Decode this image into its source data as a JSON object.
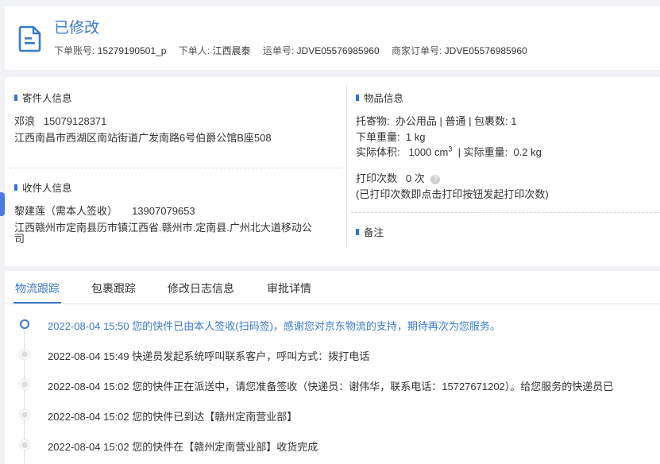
{
  "header": {
    "status": "已修改",
    "fields": [
      {
        "label": "下单账号:",
        "value": "15279190501_p"
      },
      {
        "label": "下单人:",
        "value": "江西晨泰"
      },
      {
        "label": "运单号:",
        "value": "JDVE05576985960"
      },
      {
        "label": "商家订单号:",
        "value": "JDVE05576985960"
      }
    ]
  },
  "sender": {
    "title": "寄件人信息",
    "name": "邓浪",
    "phone": "15079128371",
    "address": "江西南昌市西湖区南站街道广发南路6号伯爵公馆B座508"
  },
  "receiver": {
    "title": "收件人信息",
    "name": "黎建莲（需本人签收）",
    "phone": "13907079653",
    "address_line1": "江西赣州市定南县历市镇江西省.赣州市.定南县.广州北大道移动公",
    "address_line2": "司"
  },
  "goods": {
    "title": "物品信息",
    "consignment_label": "托寄物:",
    "consignment_value": "办公用品 | 普通 | 包裹数:  1",
    "weight_label": "下单重量:",
    "weight_value": "1 kg",
    "volume_label": "实际体积:",
    "volume_value": "1000 cm",
    "volume_sup": "3",
    "actual_weight_label": "| 实际重量:",
    "actual_weight_value": "0.2 kg",
    "print_label": "打印次数",
    "print_value": "0 次",
    "help_icon": "?",
    "print_hint": "(已打印次数即点击打印按钮发起打印次数)"
  },
  "remark": {
    "title": "备注"
  },
  "tabs": [
    "物流跟踪",
    "包裹跟踪",
    "修改日志信息",
    "审批详情"
  ],
  "timeline": [
    {
      "text": "2022-08-04 15:50 您的快件已由本人签收(扫码签)，感谢您对京东物流的支持，期待再次为您服务。",
      "active": true
    },
    {
      "text": "2022-08-04 15:49 快递员发起系统呼叫联系客户，呼叫方式：拨打电话",
      "active": false
    },
    {
      "text": "2022-08-04 15:02 您的快件正在派送中，请您准备签收（快递员：谢伟华，联系电话：15727671202）。给您服务的快递员已",
      "active": false
    },
    {
      "text": "2022-08-04 15:02 您的快件已到达【赣州定南营业部】",
      "active": false
    },
    {
      "text": "2022-08-04 15:02 您的快件在【赣州定南营业部】收货完成",
      "active": false
    }
  ],
  "colors": {
    "accent": "#3b79c8",
    "bullet": "#3a6fd8"
  }
}
